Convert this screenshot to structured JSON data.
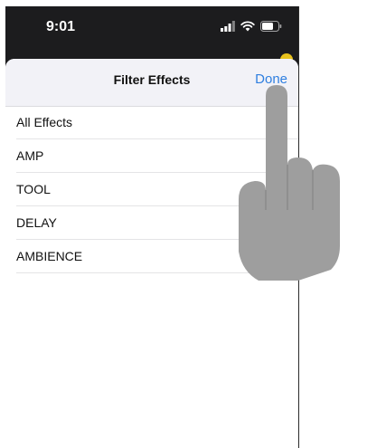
{
  "status_bar": {
    "time": "9:01"
  },
  "sheet": {
    "title": "Filter Effects",
    "done_label": "Done"
  },
  "filters": [
    {
      "label": "All Effects"
    },
    {
      "label": "AMP"
    },
    {
      "label": "TOOL"
    },
    {
      "label": "DELAY"
    },
    {
      "label": "AMBIENCE"
    }
  ],
  "colors": {
    "accent": "#2f7fe0",
    "status_bar_bg": "#1c1c1e",
    "nav_bar_bg": "#f2f2f7",
    "badge": "#e8c21d",
    "hand": "#9e9e9e"
  },
  "icons": {
    "cellular": "cellular-signal-icon",
    "wifi": "wifi-icon",
    "battery": "battery-icon",
    "pointer": "hand-pointer-icon"
  }
}
